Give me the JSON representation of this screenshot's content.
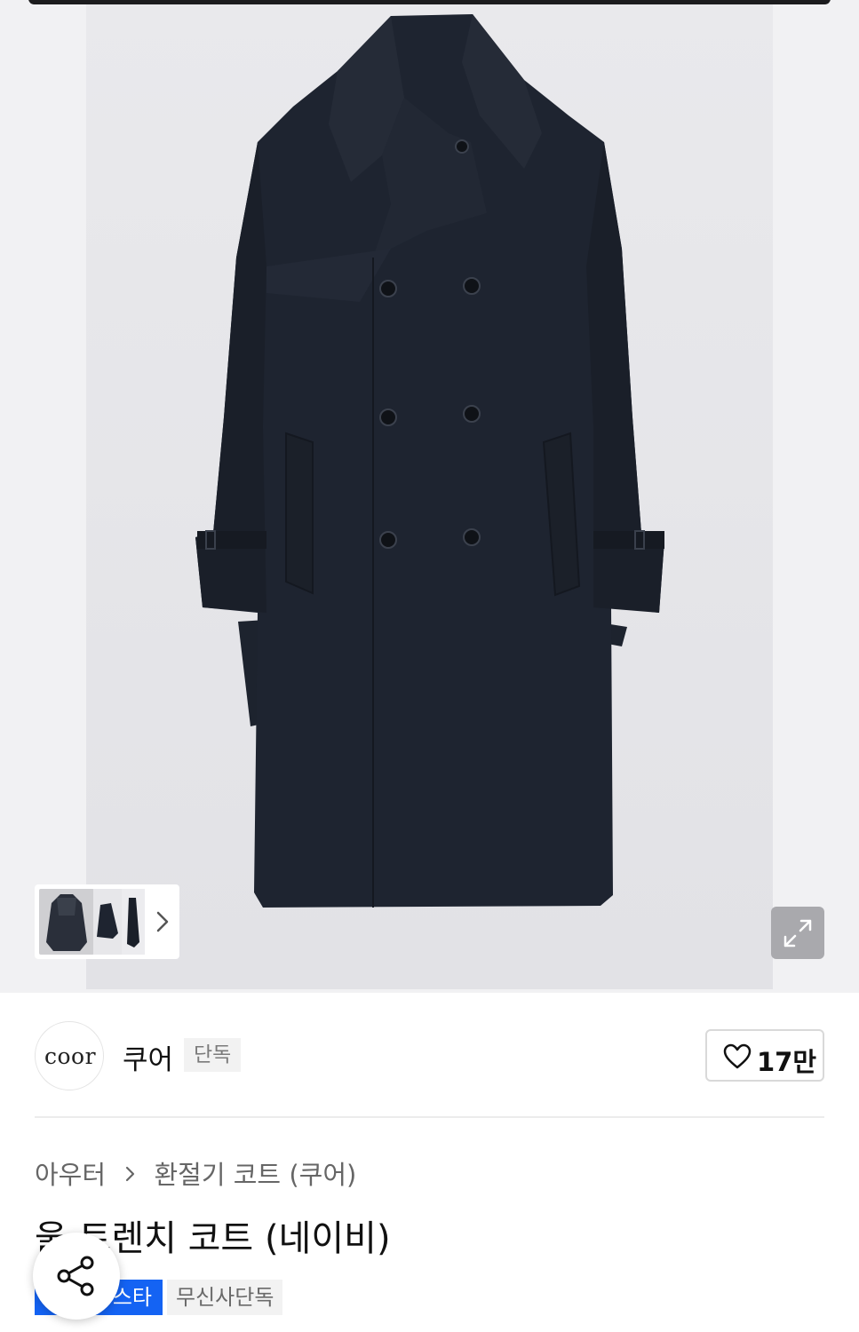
{
  "gallery": {
    "image_count": 3,
    "active_index": 0,
    "icons": {
      "next": "chevron-right-icon",
      "expand": "expand-icon"
    }
  },
  "brand": {
    "logo_text": "coor",
    "name": "쿠어",
    "tag": "단독",
    "like_count": "17만",
    "like_icon": "heart-icon"
  },
  "breadcrumb": {
    "items": [
      "아우터",
      "환절기 코트 (쿠어)"
    ],
    "separator_icon": "chevron-right-icon"
  },
  "product": {
    "title": "울 트렌치 코트 (네이비)"
  },
  "badges": [
    {
      "label": "스타",
      "color": "#1463f3"
    },
    {
      "label": "무신사단독",
      "color": "#f2f2f2"
    }
  ],
  "share": {
    "icon": "share-icon"
  },
  "colors": {
    "accent": "#1463f3",
    "coat": "#1e2430"
  }
}
